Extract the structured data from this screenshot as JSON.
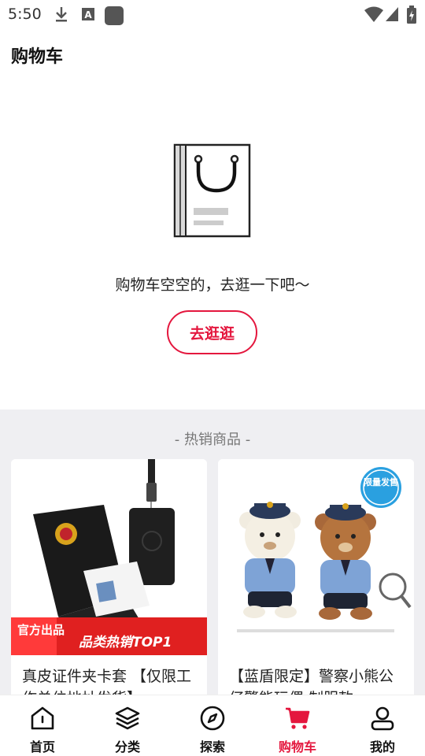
{
  "status_bar": {
    "time": "5:50",
    "icons": [
      "download-icon",
      "font-a-icon",
      "app-square-icon",
      "wifi-icon",
      "signal-icon",
      "battery-charging-icon"
    ]
  },
  "page": {
    "title": "购物车"
  },
  "empty_state": {
    "illustration": "shopping-bag-icon",
    "message": "购物车空空的，去逛一下吧～",
    "button_label": "去逛逛"
  },
  "hot_products": {
    "title": "- 热销商品 -",
    "items": [
      {
        "name": "真皮证件夹卡套 【仅限工作单位地址发货】",
        "badge_left": "官方出品",
        "badge_right": "品类热销TOP1"
      },
      {
        "name": "【蓝盾限定】警察小熊公仔警能玩偶 制服款",
        "corner_badge": "限量发售"
      }
    ]
  },
  "bottom_nav": {
    "items": [
      {
        "label": "首页",
        "icon": "home-icon"
      },
      {
        "label": "分类",
        "icon": "layers-icon"
      },
      {
        "label": "探索",
        "icon": "compass-icon"
      },
      {
        "label": "购物车",
        "icon": "cart-icon"
      },
      {
        "label": "我的",
        "icon": "user-icon"
      }
    ],
    "active_index": 3
  },
  "colors": {
    "accent": "#e4173e",
    "section_bg": "#efeff2"
  }
}
